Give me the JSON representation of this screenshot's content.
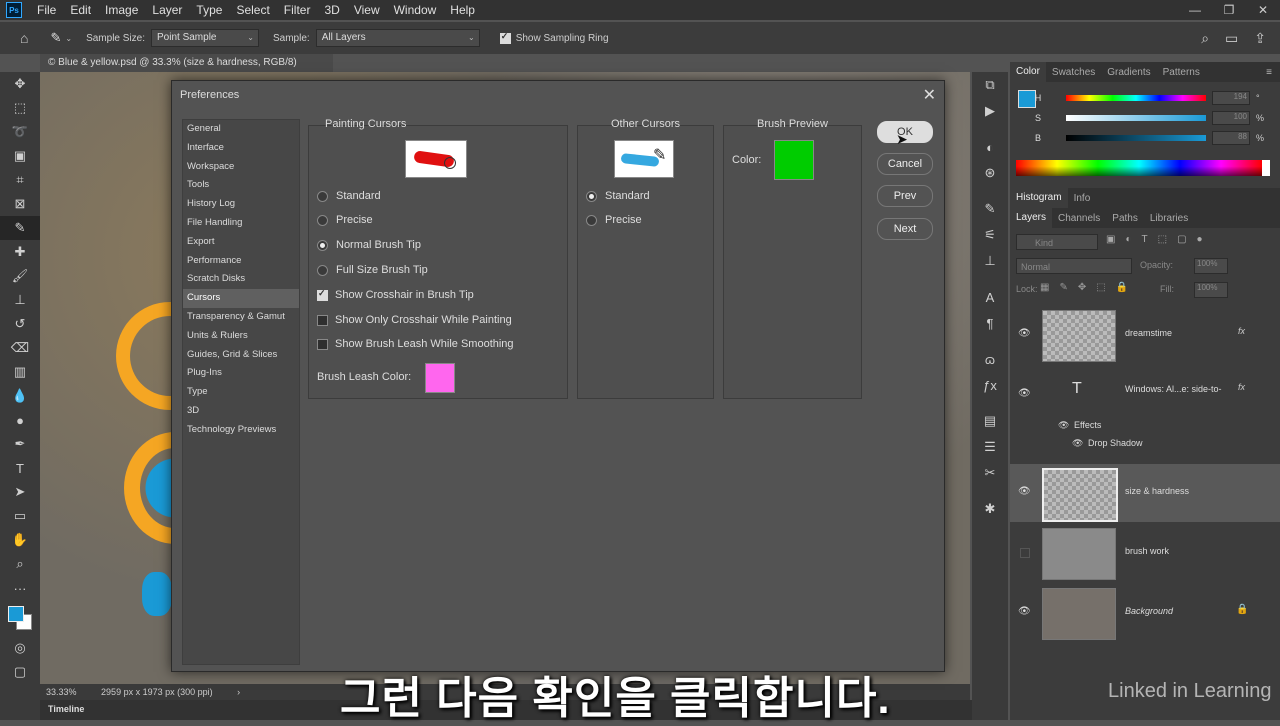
{
  "menu": [
    "File",
    "Edit",
    "Image",
    "Layer",
    "Type",
    "Select",
    "Filter",
    "3D",
    "View",
    "Window",
    "Help"
  ],
  "app_logo": "Ps",
  "window_controls": [
    "—",
    "❐",
    "✕"
  ],
  "options": {
    "sample_size_label": "Sample Size:",
    "sample_size_value": "Point Sample",
    "sample_label": "Sample:",
    "sample_value": "All Layers",
    "show_ring_label": "Show Sampling Ring"
  },
  "document_tab": "© Blue & yellow.psd @ 33.3% (size & hardness, RGB/8)",
  "status": {
    "zoom": "33.33%",
    "dims": "2959 px x 1973 px (300 ppi)"
  },
  "timeline_label": "Timeline",
  "dialog": {
    "title": "Preferences",
    "close": "✕",
    "nav": [
      "General",
      "Interface",
      "Workspace",
      "Tools",
      "History Log",
      "File Handling",
      "Export",
      "Performance",
      "Scratch Disks",
      "Cursors",
      "Transparency & Gamut",
      "Units & Rulers",
      "Guides, Grid & Slices",
      "Plug-Ins",
      "Type",
      "3D",
      "Technology Previews"
    ],
    "nav_selected": "Cursors",
    "painting": {
      "title": "Painting Cursors",
      "options": [
        "Standard",
        "Precise",
        "Normal Brush Tip",
        "Full Size Brush Tip"
      ],
      "selected": "Normal Brush Tip",
      "checks": [
        {
          "label": "Show Crosshair in Brush Tip",
          "on": true
        },
        {
          "label": "Show Only Crosshair While Painting",
          "on": false
        },
        {
          "label": "Show Brush Leash While Smoothing",
          "on": false
        }
      ],
      "leash_label": "Brush Leash Color:",
      "leash_color": "#ff66ee"
    },
    "other": {
      "title": "Other Cursors",
      "options": [
        "Standard",
        "Precise"
      ],
      "selected": "Standard"
    },
    "preview": {
      "title": "Brush Preview",
      "color_label": "Color:",
      "color": "#00cc00"
    },
    "buttons": {
      "ok": "OK",
      "cancel": "Cancel",
      "prev": "Prev",
      "next": "Next"
    }
  },
  "color_panel": {
    "tabs": [
      "Color",
      "Swatches",
      "Gradients",
      "Patterns"
    ],
    "sliders": [
      {
        "label": "H",
        "value": "194",
        "unit": "°"
      },
      {
        "label": "S",
        "value": "100",
        "unit": "%"
      },
      {
        "label": "B",
        "value": "88",
        "unit": "%"
      }
    ],
    "swatch": "#1a9ad6"
  },
  "hist_tabs": [
    "Histogram",
    "Info"
  ],
  "layers_panel": {
    "tabs": [
      "Layers",
      "Channels",
      "Paths",
      "Libraries"
    ],
    "filter_label": "Kind",
    "blend": "Normal",
    "opacity_label": "Opacity:",
    "opacity": "100%",
    "lock_label": "Lock:",
    "fill_label": "Fill:",
    "fill": "100%",
    "layers": [
      {
        "name": "dreamstime",
        "fx": "fx"
      },
      {
        "name": "Windows: Al...e: side-to-",
        "fx": "fx"
      },
      {
        "name": "size & hardness"
      },
      {
        "name": "brush work"
      },
      {
        "name": "Background"
      }
    ],
    "effects_label": "Effects",
    "drop_shadow_label": "Drop Shadow",
    "text_layer_glyph": "T"
  },
  "subtitle": "그런 다음 확인을 클릭합니다.",
  "watermark": "Linked in Learning"
}
